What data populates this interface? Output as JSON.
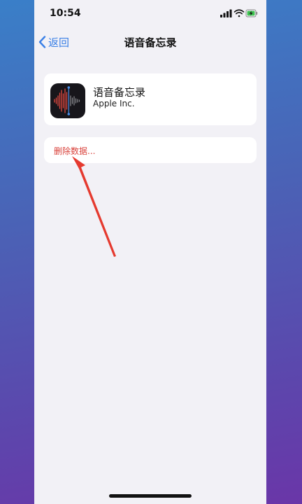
{
  "status_bar": {
    "time": "10:54",
    "icons": [
      "signal-icon",
      "wifi-icon",
      "battery-charging-icon"
    ]
  },
  "nav": {
    "back_label": "返回",
    "title": "语音备忘录"
  },
  "app": {
    "name": "语音备忘录",
    "vendor": "Apple Inc.",
    "icon": "voice-memos-waveform-icon"
  },
  "actions": {
    "delete_label": "删除数据..."
  },
  "colors": {
    "accent": "#3b80e6",
    "destructive": "#d9423b",
    "annotation_arrow": "#e53a2f",
    "background": "#f2f1f6"
  }
}
